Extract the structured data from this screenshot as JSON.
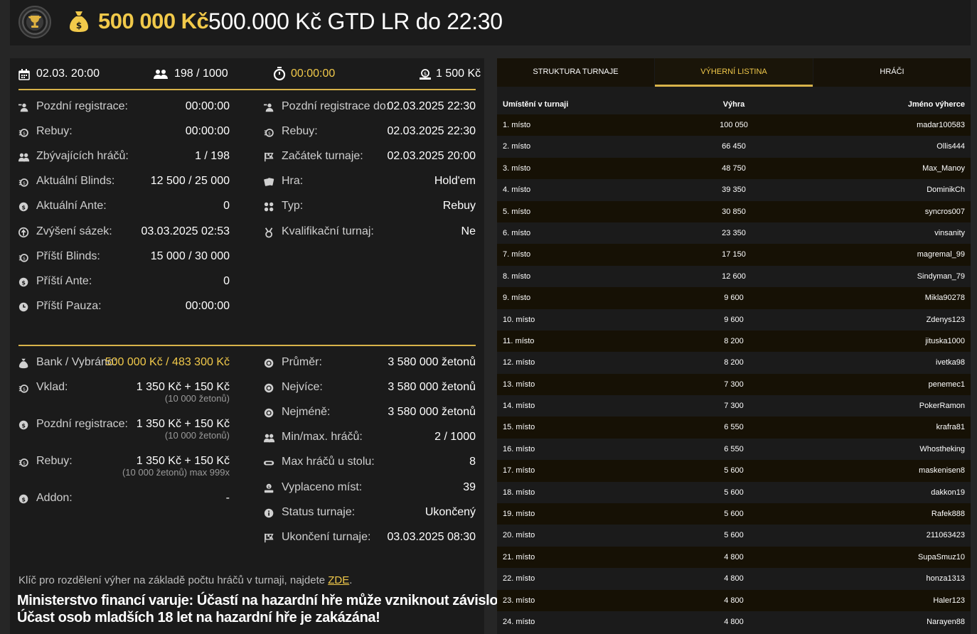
{
  "header": {
    "prize_amount": "500 000 Kč",
    "title": "500.000 Kč GTD LR do 22:30"
  },
  "top_stats": {
    "date": "02.03. 20:00",
    "players": "198 / 1000",
    "timer": "00:00:00",
    "buyin": "1 500 Kč"
  },
  "left_col": [
    {
      "icon": "late-registration-icon",
      "label": "Pozdní registrace:",
      "value": "00:00:00"
    },
    {
      "icon": "rebuy-icon",
      "label": "Rebuy:",
      "value": "00:00:00"
    },
    {
      "icon": "players-icon",
      "label": "Zbývajících hráčů:",
      "value": "1 / 198"
    },
    {
      "icon": "blinds-icon",
      "label": "Aktuální Blinds:",
      "value": "12 500 / 25 000"
    },
    {
      "icon": "ante-icon",
      "label": "Aktuální Ante:",
      "value": "0"
    },
    {
      "icon": "raise-icon",
      "label": "Zvýšení sázek:",
      "value": "03.03.2025 02:53"
    },
    {
      "icon": "next-blinds-icon",
      "label": "Příští Blinds:",
      "value": "15 000 / 30 000"
    },
    {
      "icon": "next-ante-icon",
      "label": "Příští Ante:",
      "value": "0"
    },
    {
      "icon": "clock-icon",
      "label": "Příští Pauza:",
      "value": "00:00:00"
    }
  ],
  "right_col": [
    {
      "icon": "late-registration-icon",
      "label": "Pozdní registrace do:",
      "value": "02.03.2025 22:30"
    },
    {
      "icon": "rebuy-icon",
      "label": "Rebuy:",
      "value": "02.03.2025 22:30"
    },
    {
      "icon": "flag-icon",
      "label": "Začátek turnaje:",
      "value": "02.03.2025 20:00"
    },
    {
      "icon": "cards-icon",
      "label": "Hra:",
      "value": "Hold'em"
    },
    {
      "icon": "type-icon",
      "label": "Typ:",
      "value": "Rebuy"
    },
    {
      "icon": "medal-icon",
      "label": "Kvalifikační turnaj:",
      "value": "Ne"
    }
  ],
  "bank": {
    "label": "Bank / Vybráno:",
    "value": "500 000 Kč / 483 300 Kč"
  },
  "lower_left": [
    {
      "icon": "deposit-icon",
      "label": "Vklad:",
      "value": "1 350 Kč + 150 Kč",
      "sub": "(10 000 žetonů)"
    },
    {
      "icon": "late-reg-coin-icon",
      "label": "Pozdní registrace:",
      "value": "1 350 Kč + 150 Kč",
      "sub": "(10 000 žetonů)"
    },
    {
      "icon": "rebuy-icon",
      "label": "Rebuy:",
      "value": "1 350 Kč + 150 Kč",
      "sub": "(10 000 žetonů) max 999x"
    },
    {
      "icon": "addon-icon",
      "label": "Addon:",
      "value": "-",
      "sub": ""
    }
  ],
  "lower_right": [
    {
      "icon": "chip-icon",
      "label": "Průměr:",
      "value": "3 580 000 žetonů"
    },
    {
      "icon": "chip-icon",
      "label": "Nejvíce:",
      "value": "3 580 000 žetonů"
    },
    {
      "icon": "chip-icon",
      "label": "Nejméně:",
      "value": "3 580 000 žetonů"
    },
    {
      "icon": "players-icon",
      "label": "Min/max. hráčů:",
      "value": "2 / 1000"
    },
    {
      "icon": "table-icon",
      "label": "Max hráčů u stolu:",
      "value": "8"
    },
    {
      "icon": "paid-icon",
      "label": "Vyplaceno míst:",
      "value": "39"
    },
    {
      "icon": "info-icon",
      "label": "Status turnaje:",
      "value": "Ukončený"
    },
    {
      "icon": "finish-flag-icon",
      "label": "Ukončení turnaje:",
      "value": "03.03.2025 08:30"
    }
  ],
  "footer": {
    "key_text": "Klíč pro rozdělení výher na základě počtu hráčů v turnaji, najdete ",
    "key_link": "ZDE",
    "key_end": ".",
    "warning1": "Ministerstvo financí varuje: Účastí na hazardní hře může vzniknout závislost!",
    "warning2": "Účast osob mladších 18 let na hazardní hře je zakázána!"
  },
  "tabs": [
    {
      "label": "STRUKTURA TURNAJE",
      "active": false
    },
    {
      "label": "VÝHERNÍ LISTINA",
      "active": true
    },
    {
      "label": "HRÁČI",
      "active": false
    }
  ],
  "table": {
    "headers": [
      "Umístění v turnaji",
      "Výhra",
      "Jméno výherce"
    ],
    "rows": [
      [
        "1. místo",
        "100 050",
        "madar100583"
      ],
      [
        "2. místo",
        "66 450",
        "Ollis444"
      ],
      [
        "3. místo",
        "48 750",
        "Max_Manoy"
      ],
      [
        "4. místo",
        "39 350",
        "DominikCh"
      ],
      [
        "5. místo",
        "30 850",
        "syncros007"
      ],
      [
        "6. místo",
        "23 350",
        "vinsanity"
      ],
      [
        "7. místo",
        "17 150",
        "magremal_99"
      ],
      [
        "8. místo",
        "12 600",
        "Sindyman_79"
      ],
      [
        "9. místo",
        "9 600",
        "Mikla90278"
      ],
      [
        "10. místo",
        "9 600",
        "Zdenys123"
      ],
      [
        "11. místo",
        "8 200",
        "jituska1000"
      ],
      [
        "12. místo",
        "8 200",
        "ivetka98"
      ],
      [
        "13. místo",
        "7 300",
        "penemec1"
      ],
      [
        "14. místo",
        "7 300",
        "PokerRamon"
      ],
      [
        "15. místo",
        "6 550",
        "krafra81"
      ],
      [
        "16. místo",
        "6 550",
        "Whostheking"
      ],
      [
        "17. místo",
        "5 600",
        "maskenisen8"
      ],
      [
        "18. místo",
        "5 600",
        "dakkon19"
      ],
      [
        "19. místo",
        "5 600",
        "Rafek888"
      ],
      [
        "20. místo",
        "5 600",
        "211063423"
      ],
      [
        "21. místo",
        "4 800",
        "SupaSmuz10"
      ],
      [
        "22. místo",
        "4 800",
        "honza1313"
      ],
      [
        "23. místo",
        "4 800",
        "Haler123"
      ],
      [
        "24. místo",
        "4 800",
        "Narayen88"
      ]
    ]
  },
  "colors": {
    "gold": "#f1c94a",
    "panel": "#1b1b1b",
    "bg": "#262626"
  }
}
